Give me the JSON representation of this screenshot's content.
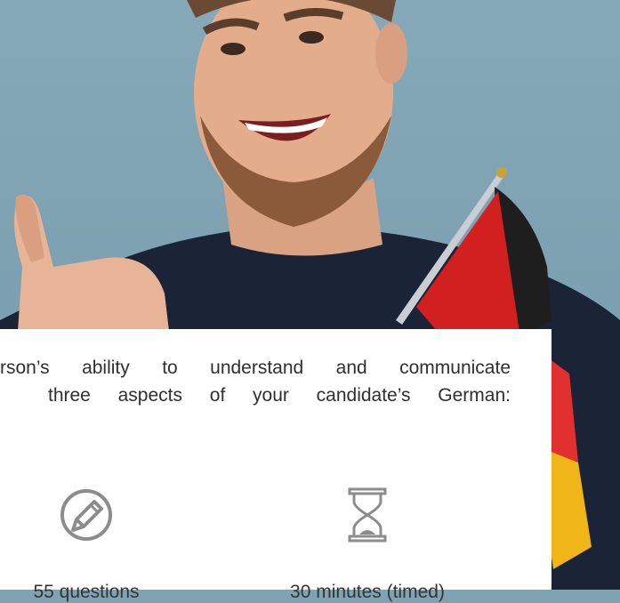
{
  "hero": {
    "icon": "thumbs-up-man-with-german-flag-photo"
  },
  "intro": {
    "line1": "rson’s ability to understand and communicate",
    "line2": "three aspects of your candidate’s German:"
  },
  "stats": [
    {
      "icon": "pencil-circle-icon",
      "label": "55 questions"
    },
    {
      "icon": "hourglass-icon",
      "label": "30 minutes (timed)"
    }
  ],
  "colors": {
    "background": "#7fa3b3",
    "card": "#ffffff",
    "text": "#2f2f2f",
    "icon": "#8c8c8c"
  }
}
